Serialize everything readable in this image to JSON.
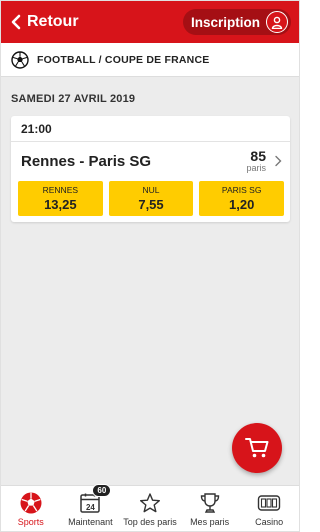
{
  "header": {
    "back_label": "Retour",
    "signup_label": "Inscription"
  },
  "breadcrumb": {
    "text": "FOOTBALL / COUPE DE FRANCE",
    "icon": "soccer-ball-icon"
  },
  "date": "SAMEDI 27 AVRIL 2019",
  "match": {
    "time": "21:00",
    "name": "Rennes - Paris SG",
    "bets_count": "85",
    "bets_label": "paris",
    "odds": [
      {
        "label": "RENNES",
        "value": "13,25"
      },
      {
        "label": "NUL",
        "value": "7,55"
      },
      {
        "label": "PARIS SG",
        "value": "1,20"
      }
    ]
  },
  "nav": {
    "items": [
      {
        "label": "Sports",
        "icon": "soccer-ball-icon",
        "active": true
      },
      {
        "label": "Maintenant",
        "icon": "calendar-icon",
        "badge": "60",
        "calendar_day": "24"
      },
      {
        "label": "Top des paris",
        "icon": "star-icon"
      },
      {
        "label": "Mes paris",
        "icon": "trophy-icon"
      },
      {
        "label": "Casino",
        "icon": "slot-machine-icon"
      }
    ]
  },
  "colors": {
    "brand_red": "#d7141a",
    "odds_yellow": "#ffcc00"
  }
}
